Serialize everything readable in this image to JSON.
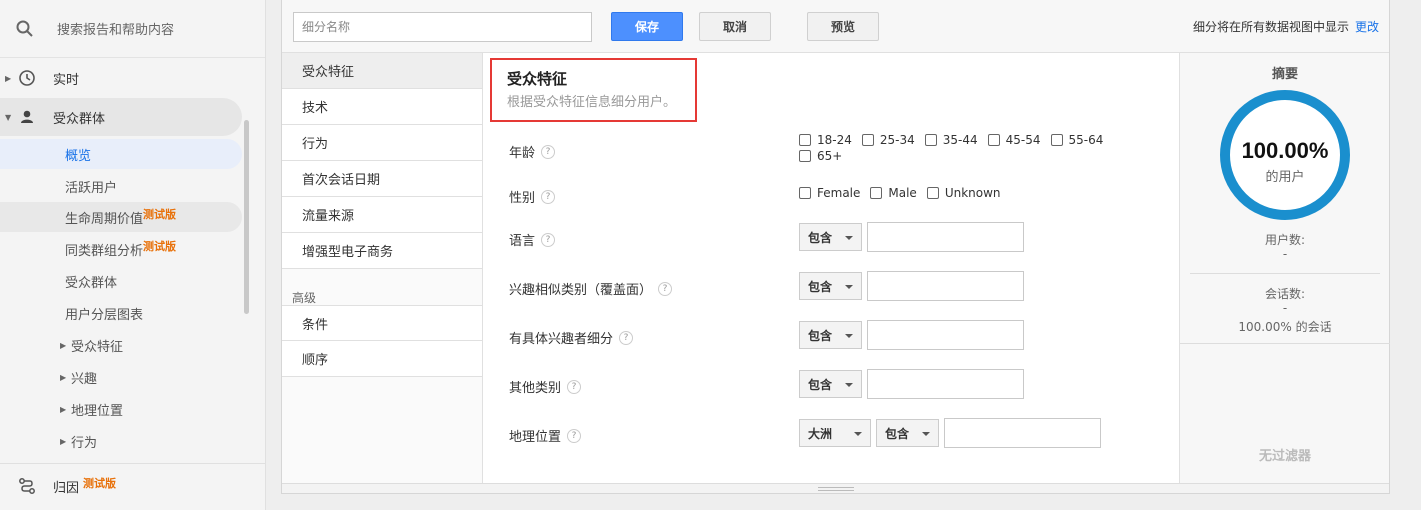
{
  "nav": {
    "search_placeholder": "搜索报告和帮助内容",
    "realtime": "实时",
    "audience": "受众群体",
    "sub": {
      "overview": "概览",
      "active_users": "活跃用户",
      "lifetime_value": "生命周期价值",
      "cohort": "同类群组分析",
      "audiences": "受众群体",
      "user_explorer": "用户分层图表",
      "demographics": "受众特征",
      "interests": "兴趣",
      "geo": "地理位置",
      "behavior": "行为"
    },
    "beta": "测试版",
    "attribution": "归因"
  },
  "toolbar": {
    "name_placeholder": "细分名称",
    "save": "保存",
    "cancel": "取消",
    "preview": "预览",
    "note": "细分将在所有数据视图中显示",
    "change": "更改"
  },
  "categories": [
    "受众特征",
    "技术",
    "行为",
    "首次会话日期",
    "流量来源",
    "增强型电子商务"
  ],
  "advanced_heading": "高级",
  "advanced": [
    "条件",
    "顺序"
  ],
  "section": {
    "title": "受众特征",
    "subtitle": "根据受众特征信息细分用户。"
  },
  "fields": {
    "age": "年龄",
    "age_options": [
      "18-24",
      "25-34",
      "35-44",
      "45-54",
      "55-64",
      "65+"
    ],
    "gender": "性别",
    "gender_options": [
      "Female",
      "Male",
      "Unknown"
    ],
    "language": "语言",
    "affinity": "兴趣相似类别（覆盖面）",
    "in_market": "有具体兴趣者细分",
    "other": "其他类别",
    "location": "地理位置",
    "contains": "包含",
    "continent": "大洲",
    "help": "?"
  },
  "summary": {
    "title": "摘要",
    "percent": "100.00%",
    "of_users": "的用户",
    "users_label": "用户数:",
    "users_value": "-",
    "sessions_label": "会话数:",
    "sessions_value": "-",
    "sessions_pct": "100.00% 的会话",
    "no_filter": "无过滤器"
  },
  "colors": {
    "accent": "#1a8fce",
    "primary_button": "#4d90fe",
    "highlight_box": "#e53935",
    "beta": "#e8710a"
  }
}
